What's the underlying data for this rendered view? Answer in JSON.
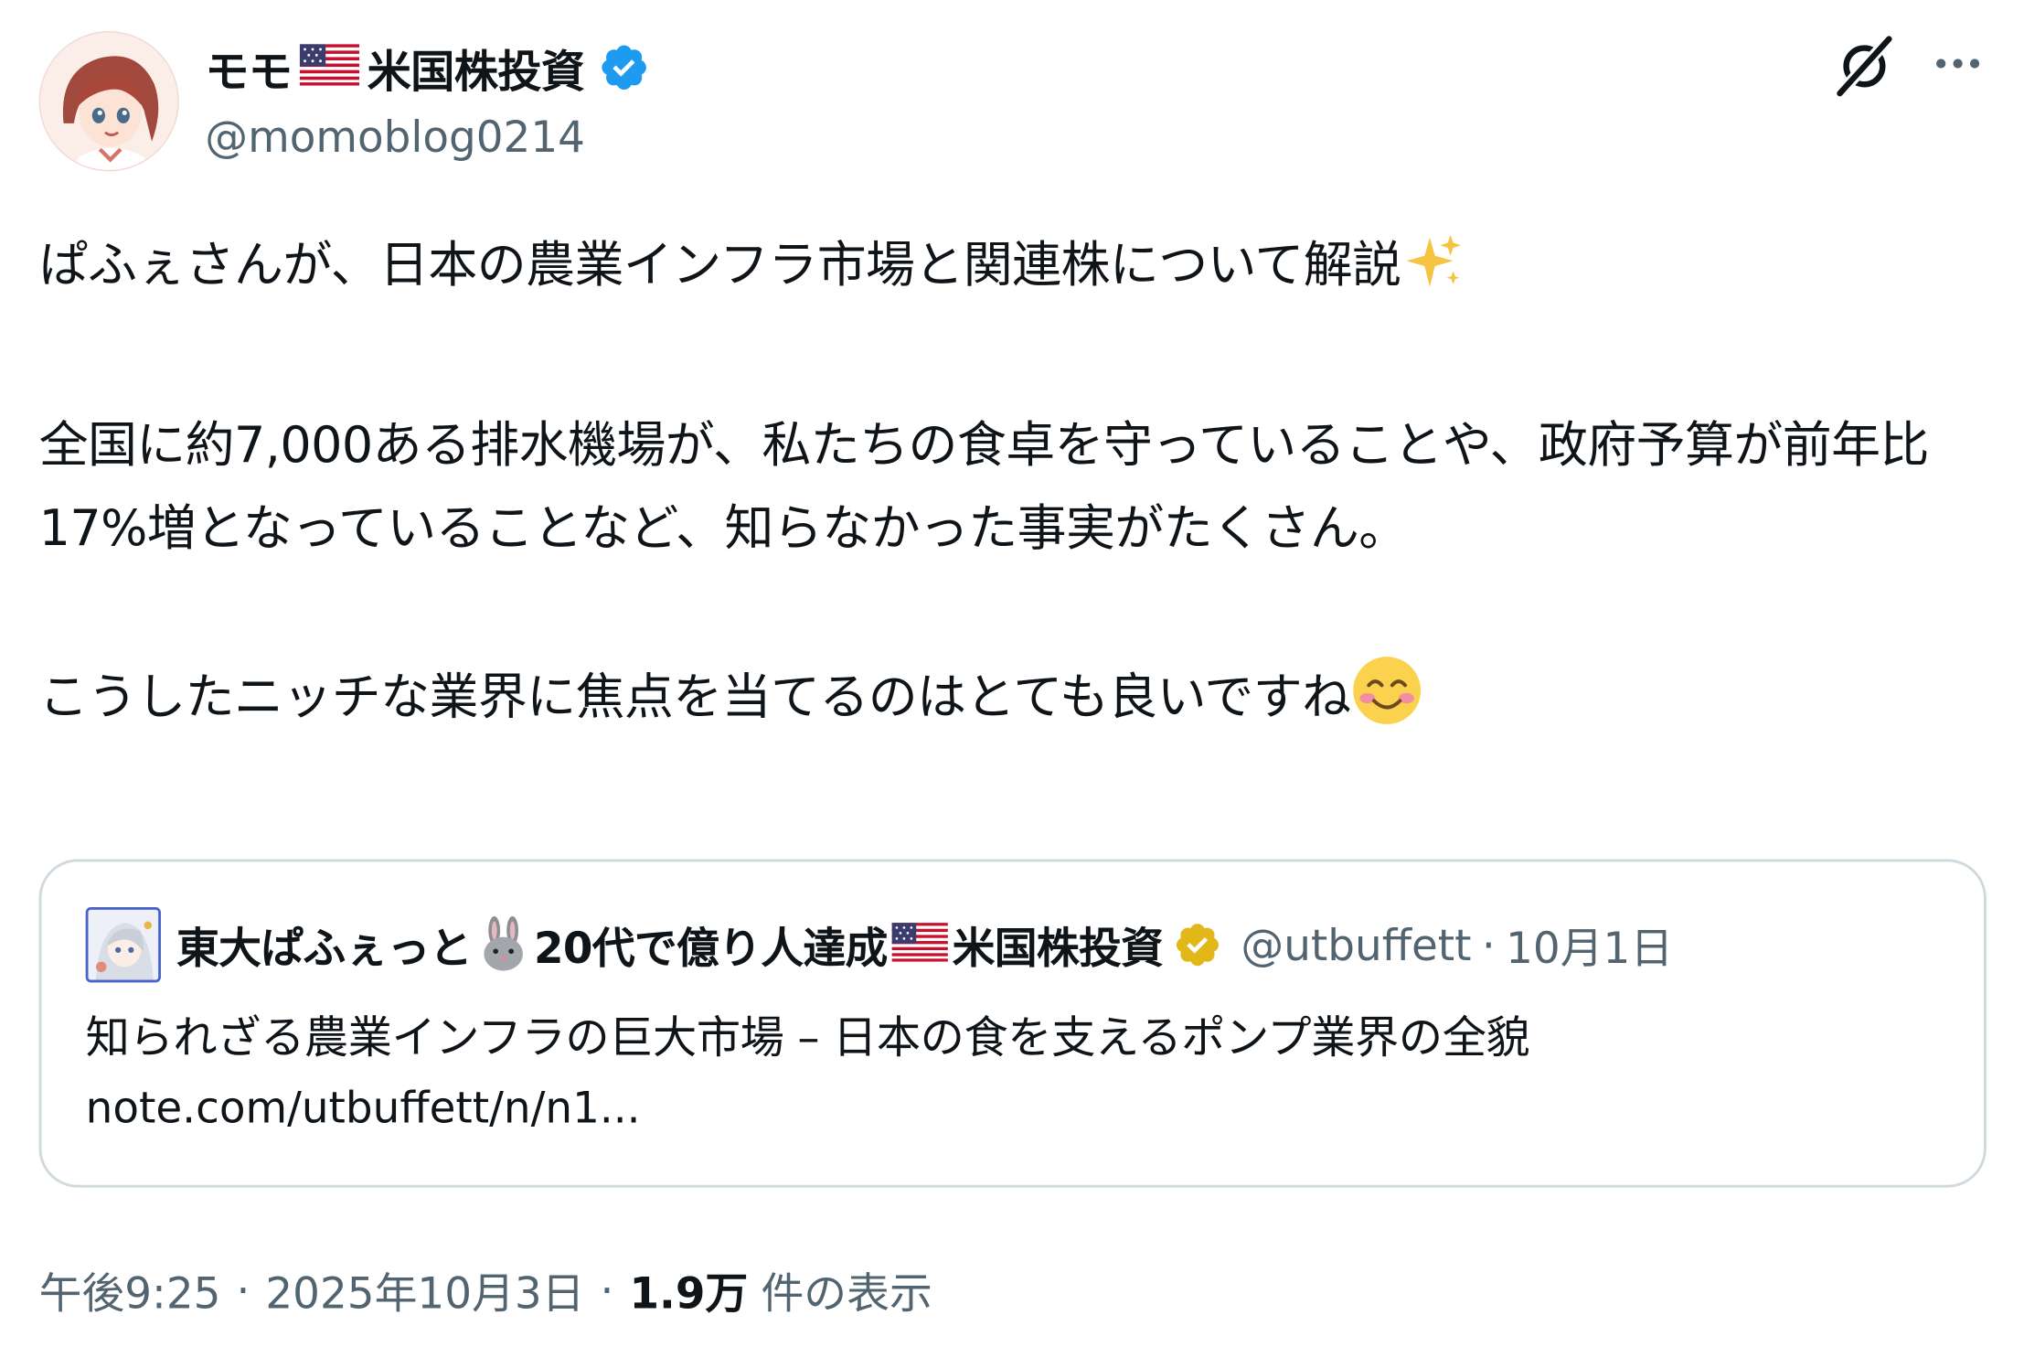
{
  "author": {
    "display_name": "モモ",
    "flag_icon": "us-flag-icon",
    "display_name_suffix": "米国株投資",
    "handle": "@momoblog0214",
    "verified_color": "#1d9bf0"
  },
  "header_actions": {
    "grok_icon": "grok-icon",
    "more_icon": "more-icon"
  },
  "tweet": {
    "line1": "ぱふぇさんが、日本の農業インフラ市場と関連株について解説",
    "line1_emoji": "sparkles-emoji",
    "para2": "全国に約7,000ある排水機場が、私たちの食卓を守っていることや、政府予算が前年比17%増となっていることなど、知らなかった事実がたくさん。",
    "para3": "こうしたニッチな業界に焦点を当てるのはとても良いですね",
    "para3_emoji": "smiling-face-emoji"
  },
  "quote": {
    "name_part1": "東大ぱふぇっと",
    "rabbit_emoji": "rabbit-emoji",
    "name_part2": "20代で億り人達成",
    "flag_icon": "us-flag-icon",
    "name_part3": "米国株投資",
    "verified_color": "#e2b719",
    "handle": "@utbuffett",
    "dot": "·",
    "date": "10月1日",
    "title": "知られざる農業インフラの巨大市場 – 日本の食を支えるポンプ業界の全貌",
    "link": "note.com/utbuffett/n/n1..."
  },
  "meta": {
    "time": "午後9:25",
    "sep": "·",
    "date": "2025年10月3日",
    "views_count": "1.9万",
    "views_label": "件の表示"
  }
}
